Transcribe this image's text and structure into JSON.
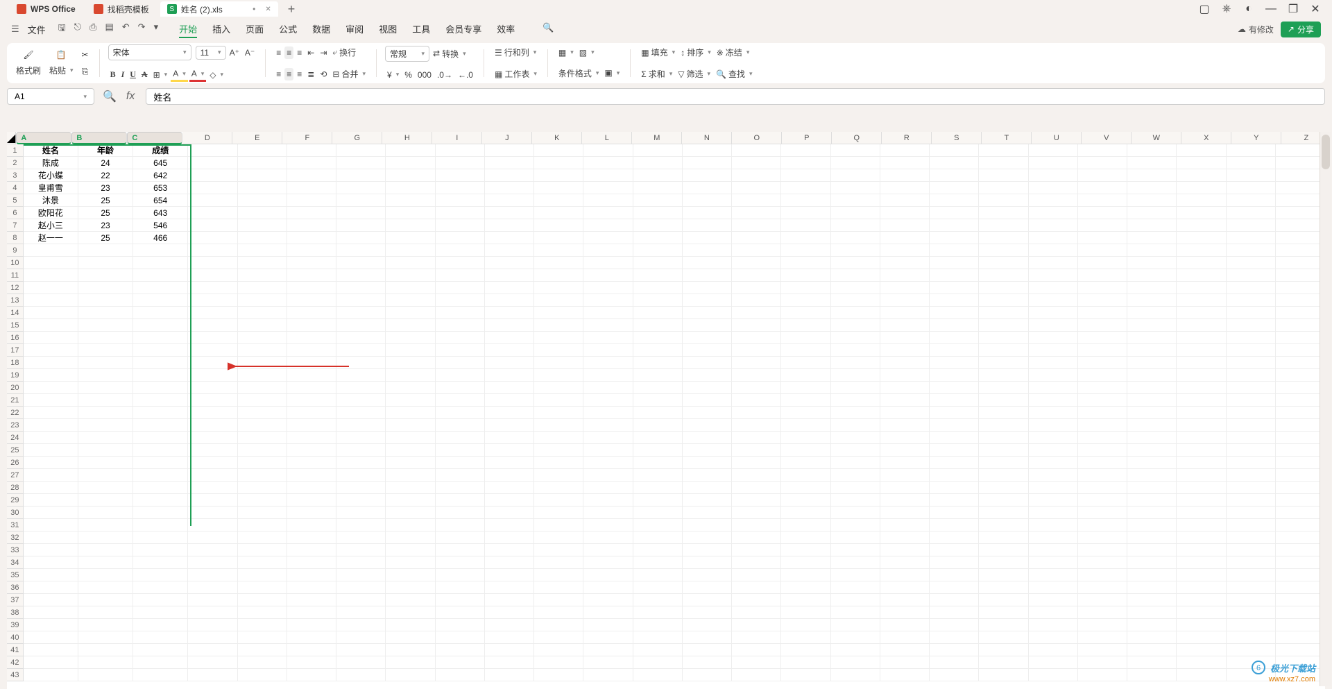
{
  "titlebar": {
    "app": "WPS Office",
    "tab_template": "找稻壳模板",
    "tab_doc": "姓名 (2).xls",
    "sheet_badge": "S"
  },
  "menu": {
    "file": "文件",
    "tabs": [
      "开始",
      "插入",
      "页面",
      "公式",
      "数据",
      "审阅",
      "视图",
      "工具",
      "会员专享",
      "效率"
    ],
    "modify": "有修改",
    "share": "分享"
  },
  "ribbon": {
    "format_brush": "格式刷",
    "paste": "粘贴",
    "font_name": "宋体",
    "font_size": "11",
    "bold": "B",
    "italic": "I",
    "underline": "U",
    "strike": "A",
    "number_format": "常规",
    "wrap": "换行",
    "convert": "转换",
    "rowcol": "行和列",
    "currency": "¥",
    "percent": "%",
    "worksheet": "工作表",
    "cond_fmt": "条件格式",
    "fill": "填充",
    "sort": "排序",
    "freeze": "冻结",
    "sum": "求和",
    "filter": "筛选",
    "find": "查找",
    "merge": "合并"
  },
  "namebox": "A1",
  "formula_label": "fx",
  "formula": "姓名",
  "columns": [
    "A",
    "B",
    "C",
    "D",
    "E",
    "F",
    "G",
    "H",
    "I",
    "J",
    "K",
    "L",
    "M",
    "N",
    "O",
    "P",
    "Q",
    "R",
    "S",
    "T",
    "U",
    "V",
    "W",
    "X",
    "Y",
    "Z"
  ],
  "col_width_default": 72,
  "col_width_abc": 80,
  "row_count": 43,
  "headers": [
    "姓名",
    "年龄",
    "成绩"
  ],
  "data": [
    [
      "陈成",
      "24",
      "645"
    ],
    [
      "花小蝶",
      "22",
      "642"
    ],
    [
      "皇甫雪",
      "23",
      "653"
    ],
    [
      "沐景",
      "25",
      "654"
    ],
    [
      "欧阳花",
      "25",
      "643"
    ],
    [
      "赵小三",
      "23",
      "546"
    ],
    [
      "赵一一",
      "25",
      "466"
    ]
  ],
  "watermark": {
    "line1": "极光下载站",
    "line2": "www.xz7.com"
  }
}
